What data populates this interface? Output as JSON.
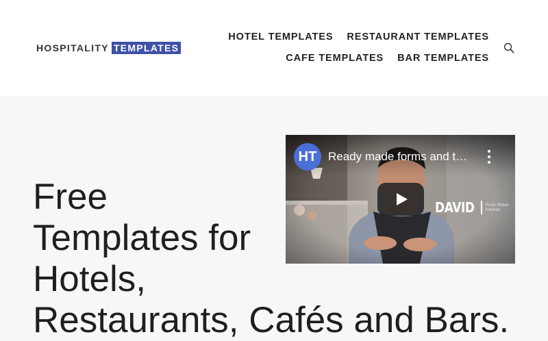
{
  "brand": {
    "logo_text_plain": "HOSPITALITY",
    "logo_text_boxed": "TEMPLATES",
    "accent_color": "#3f51a5"
  },
  "nav": {
    "items": [
      {
        "label": "HOTEL TEMPLATES"
      },
      {
        "label": "RESTAURANT TEMPLATES"
      },
      {
        "label": "CAFE TEMPLATES"
      },
      {
        "label": "BAR TEMPLATES"
      }
    ],
    "search_icon": "search-icon"
  },
  "hero": {
    "title_lines": [
      "Free",
      "Templates for",
      "Hotels,",
      "Restaurants, Cafés and Bars."
    ]
  },
  "video": {
    "channel_initials": "HT",
    "title": "Ready made forms and t…",
    "menu_icon": "more-vertical-icon",
    "play_icon": "play-icon",
    "overlay_name": "DAVID",
    "overlay_place": "Rock Street Kitchen"
  }
}
